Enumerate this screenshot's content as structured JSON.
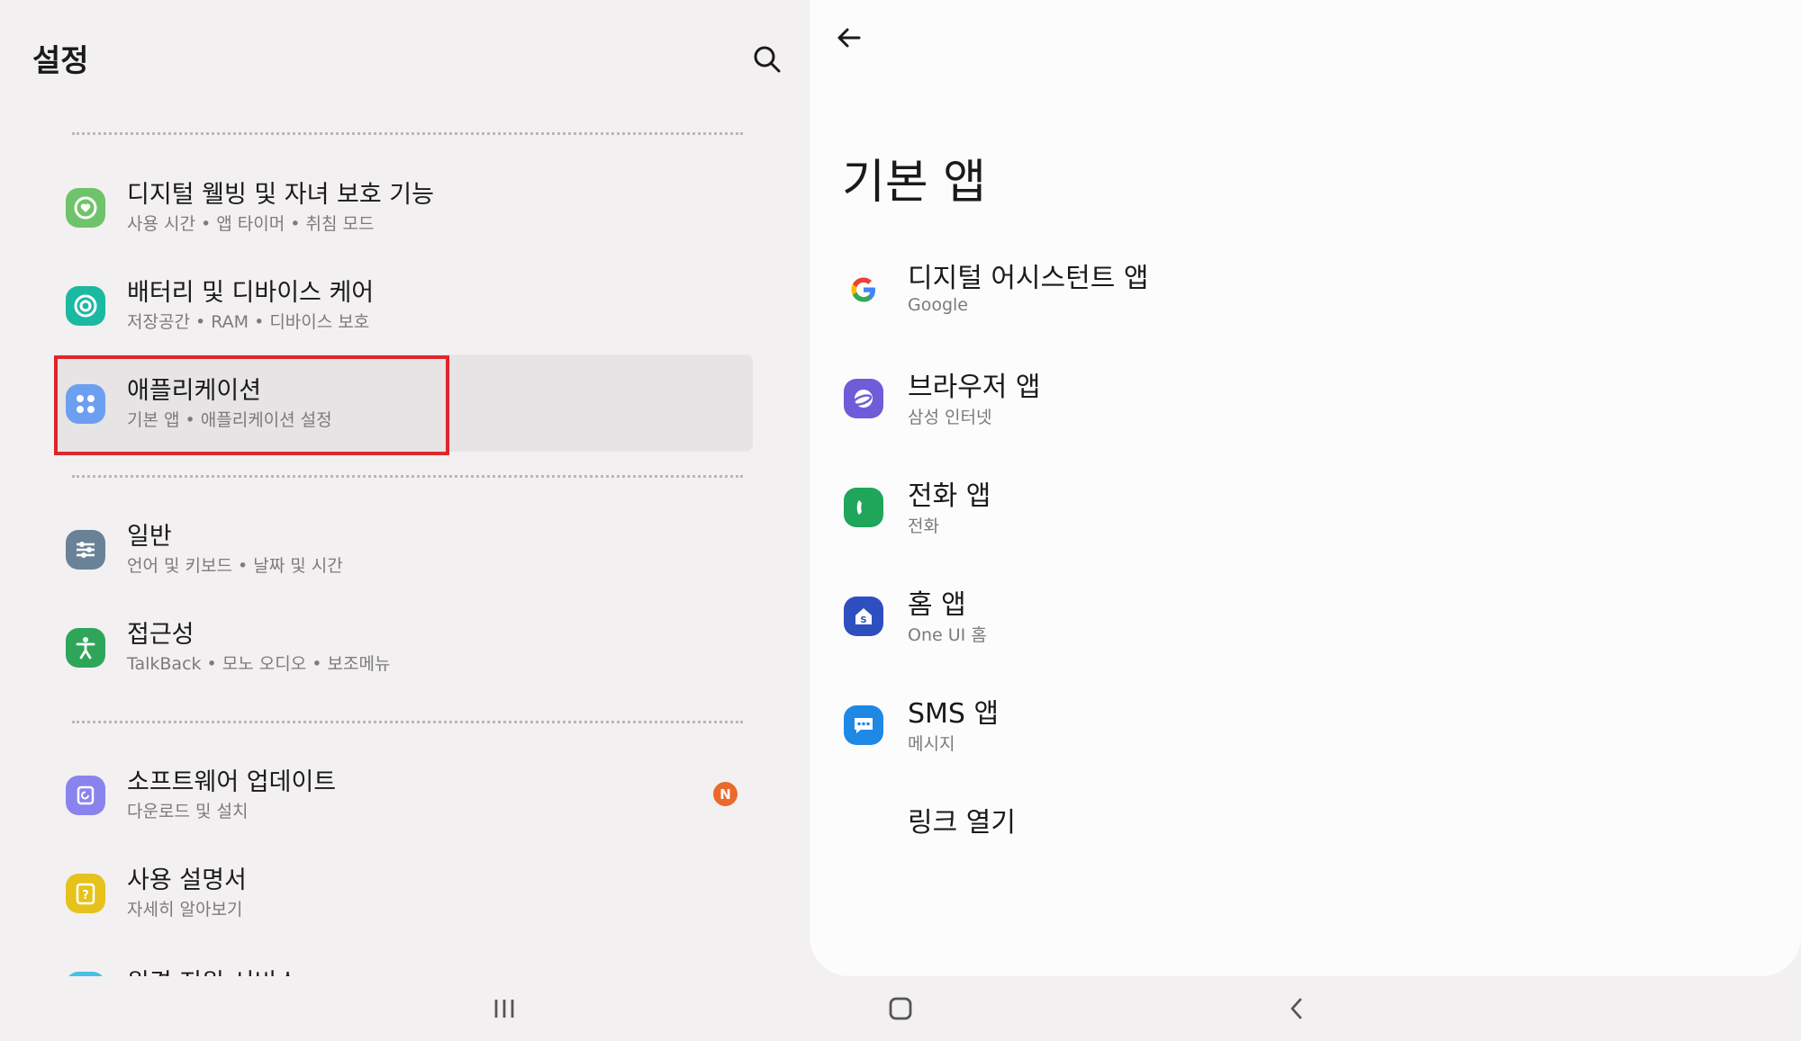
{
  "left": {
    "title": "설정",
    "items": [
      {
        "title": "디지털 웰빙 및 자녀 보호 기능",
        "subtitle": "사용 시간 • 앱 타이머 • 취침 모드",
        "icon": "digital-wellbeing-icon",
        "color": "#6fc36a"
      },
      {
        "title": "배터리 및 디바이스 케어",
        "subtitle": "저장공간 • RAM • 디바이스 보호",
        "icon": "device-care-icon",
        "color": "#1bb8a2"
      },
      {
        "title": "애플리케이션",
        "subtitle": "기본 앱 • 애플리케이션 설정",
        "icon": "apps-icon",
        "color": "#6d9ff0"
      },
      {
        "title": "일반",
        "subtitle": "언어 및 키보드 • 날짜 및 시간",
        "icon": "general-icon",
        "color": "#6a8298"
      },
      {
        "title": "접근성",
        "subtitle": "TalkBack • 모노 오디오 • 보조메뉴",
        "icon": "accessibility-icon",
        "color": "#2fa55a"
      },
      {
        "title": "소프트웨어 업데이트",
        "subtitle": "다운로드 및 설치",
        "icon": "software-update-icon",
        "color": "#8a83ee",
        "badge": "N"
      },
      {
        "title": "사용 설명서",
        "subtitle": "자세히 알아보기",
        "icon": "user-manual-icon",
        "color": "#e6c21c"
      },
      {
        "title": "원격 지원 서비스",
        "icon": "remote-support-icon",
        "color": "#44c1e4"
      }
    ]
  },
  "right": {
    "title": "기본 앱",
    "rows": [
      {
        "title": "디지털 어시스턴트 앱",
        "subtitle": "Google",
        "icon": "google-icon"
      },
      {
        "title": "브라우저 앱",
        "subtitle": "삼성 인터넷",
        "icon": "samsung-internet-icon",
        "color": "#6e5cd8"
      },
      {
        "title": "전화 앱",
        "subtitle": "전화",
        "icon": "phone-icon",
        "color": "#1fa65a"
      },
      {
        "title": "홈 앱",
        "subtitle": "One UI 홈",
        "icon": "one-ui-home-icon",
        "color": "#2e4fc0"
      },
      {
        "title": "SMS 앱",
        "subtitle": "메시지",
        "icon": "messages-icon",
        "color": "#1e88e5"
      },
      {
        "title": "링크 열기"
      }
    ]
  },
  "nav": {
    "recents_icon": "recents-icon",
    "home_icon": "home-icon",
    "back_icon": "back-icon"
  }
}
